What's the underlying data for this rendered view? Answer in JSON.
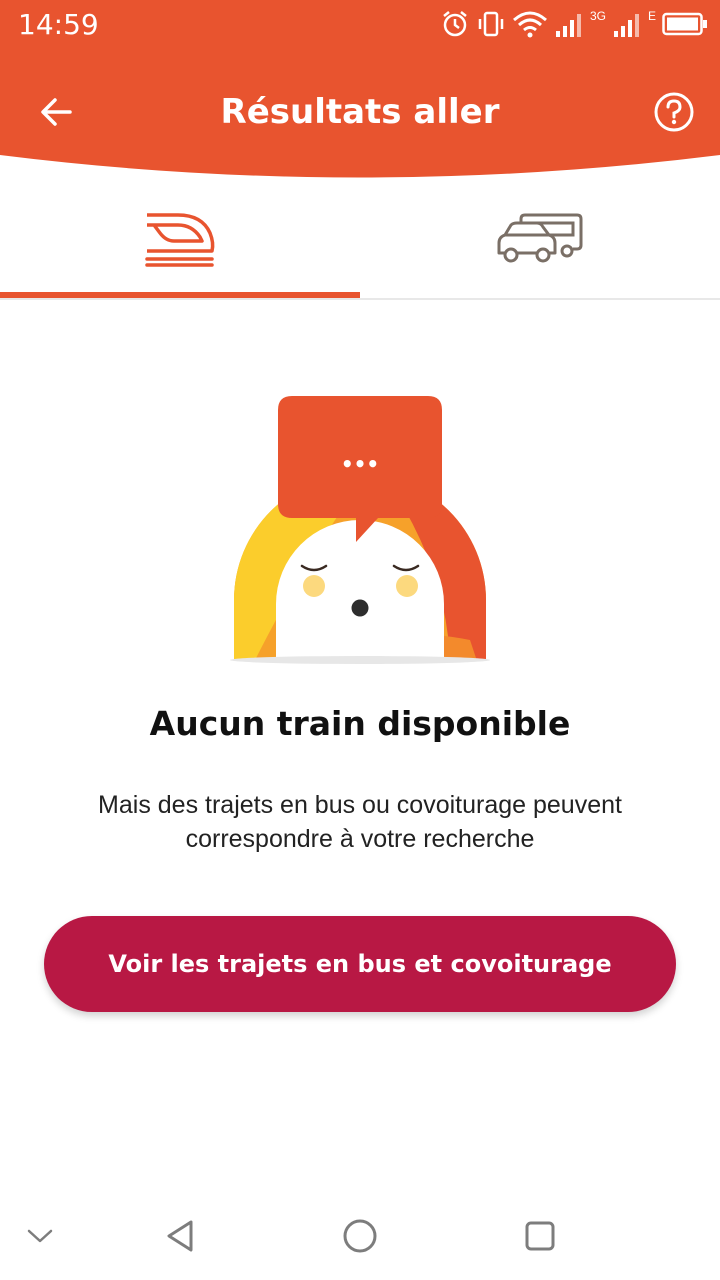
{
  "status_bar": {
    "time": "14:59",
    "network_label_1": "3G",
    "network_label_2": "E",
    "icons": [
      "alarm-icon",
      "vibrate-icon",
      "wifi-icon",
      "signal-icon",
      "signal-icon",
      "battery-icon"
    ]
  },
  "header": {
    "title": "Résultats aller",
    "back_icon": "arrow-left-icon",
    "help_icon": "question-circle-icon"
  },
  "tabs": [
    {
      "name": "train",
      "icon": "train-icon",
      "selected": true
    },
    {
      "name": "bus-covoiturage",
      "icon": "bus-car-icon",
      "selected": false
    }
  ],
  "empty_state": {
    "speech_bubble_text": "•••",
    "title": "Aucun train disponible",
    "subtitle_line1": "Mais des trajets en bus ou covoiturage peuvent",
    "subtitle_line2": "correspondre à votre recherche"
  },
  "cta": {
    "label": "Voir les trajets en bus et covoiturage"
  },
  "colors": {
    "brand_orange": "#e8542f",
    "cta_red": "#b81844",
    "tab_inactive": "#7a6f66"
  },
  "nav_bar": {
    "icons": [
      "chevron-down-icon",
      "back-triangle-icon",
      "home-circle-icon",
      "recents-square-icon"
    ]
  }
}
